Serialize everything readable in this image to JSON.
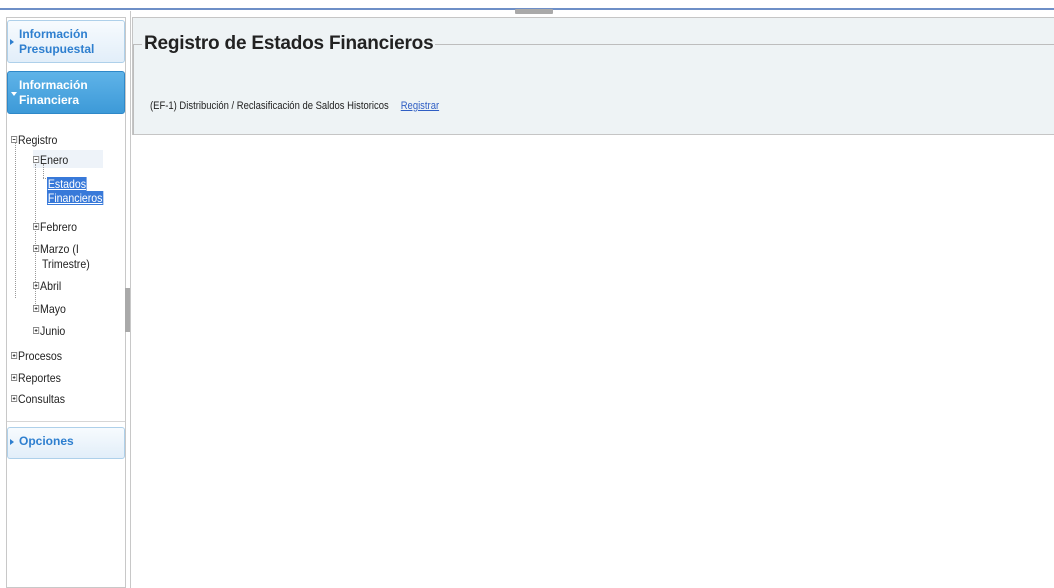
{
  "sidebar": {
    "sections": [
      {
        "label_line1": "Información",
        "label_line2": "Presupuestal"
      },
      {
        "label_line1": "Información",
        "label_line2": "Financiera"
      },
      {
        "label_line1": "Opciones"
      }
    ],
    "tree": {
      "registro": "Registro",
      "enero": "Enero",
      "selected_line1": "Estados",
      "selected_line2": "Financieros",
      "febrero": "Febrero",
      "marzo_line1": "Marzo (I",
      "marzo_line2": "Trimestre)",
      "abril": "Abril",
      "mayo": "Mayo",
      "junio": "Junio",
      "procesos": "Procesos",
      "reportes": "Reportes",
      "consultas": "Consultas"
    }
  },
  "main": {
    "title": "Registro de Estados Financieros",
    "row": {
      "text": "(EF-1) Distribución / Reclasificación de Saldos Historicos",
      "link": "Registrar"
    }
  },
  "colors": {
    "accent_blue": "#2e7fcf",
    "active_header": "#3d9ad8",
    "selection": "#3879d9",
    "panel_bg": "#eef3f5"
  },
  "icons": {
    "collapsed": "plus-box-icon",
    "expanded": "minus-box-icon",
    "section_arrow": "triangle-right-icon"
  }
}
